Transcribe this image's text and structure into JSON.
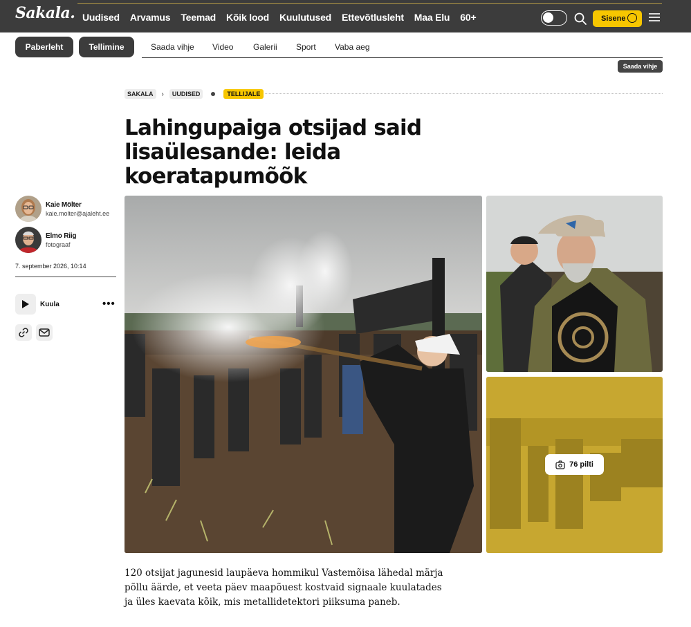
{
  "header": {
    "logo": "Sakala.",
    "nav": [
      "Uudised",
      "Arvamus",
      "Teemad",
      "Kõik lood",
      "Kuulutused",
      "Ettevõtlusleht",
      "Maa Elu",
      "60+"
    ],
    "login_label": "Sisene"
  },
  "subnav": {
    "paper_label": "Paberleht",
    "subscribe_label": "Tellimine",
    "links": [
      "Saada vihje",
      "Video",
      "Galerii",
      "Sport",
      "Vaba aeg"
    ],
    "tip_badge": "Saada vihje"
  },
  "breadcrumb": {
    "site": "SAKALA",
    "section": "UUDISED",
    "tag": "TELLIJALE"
  },
  "article": {
    "headline": "Lahingupaiga otsijad said lisaülesande: leida koeratapumõõk",
    "date": "7. september 2026, 10:14",
    "lead": "120 otsijat jagunesid laupäeva hommikul Vastemõisa lähedal märja põllu äärde, et veeta päev maapõuest kostvaid signaale kuulatades ja üles kaevata kõik, mis metallidetektori piiksuma paneb."
  },
  "authors": [
    {
      "name": "Kaie Mölter",
      "sub": "kaie.molter@ajaleht.ee"
    },
    {
      "name": "Elmo Riig",
      "sub": "fotograaf"
    }
  ],
  "audio": {
    "label": "Kuula"
  },
  "gallery": {
    "count_label": "76 pilti"
  },
  "colors": {
    "accent": "#f7c600",
    "topbar": "#3c3c3c"
  }
}
